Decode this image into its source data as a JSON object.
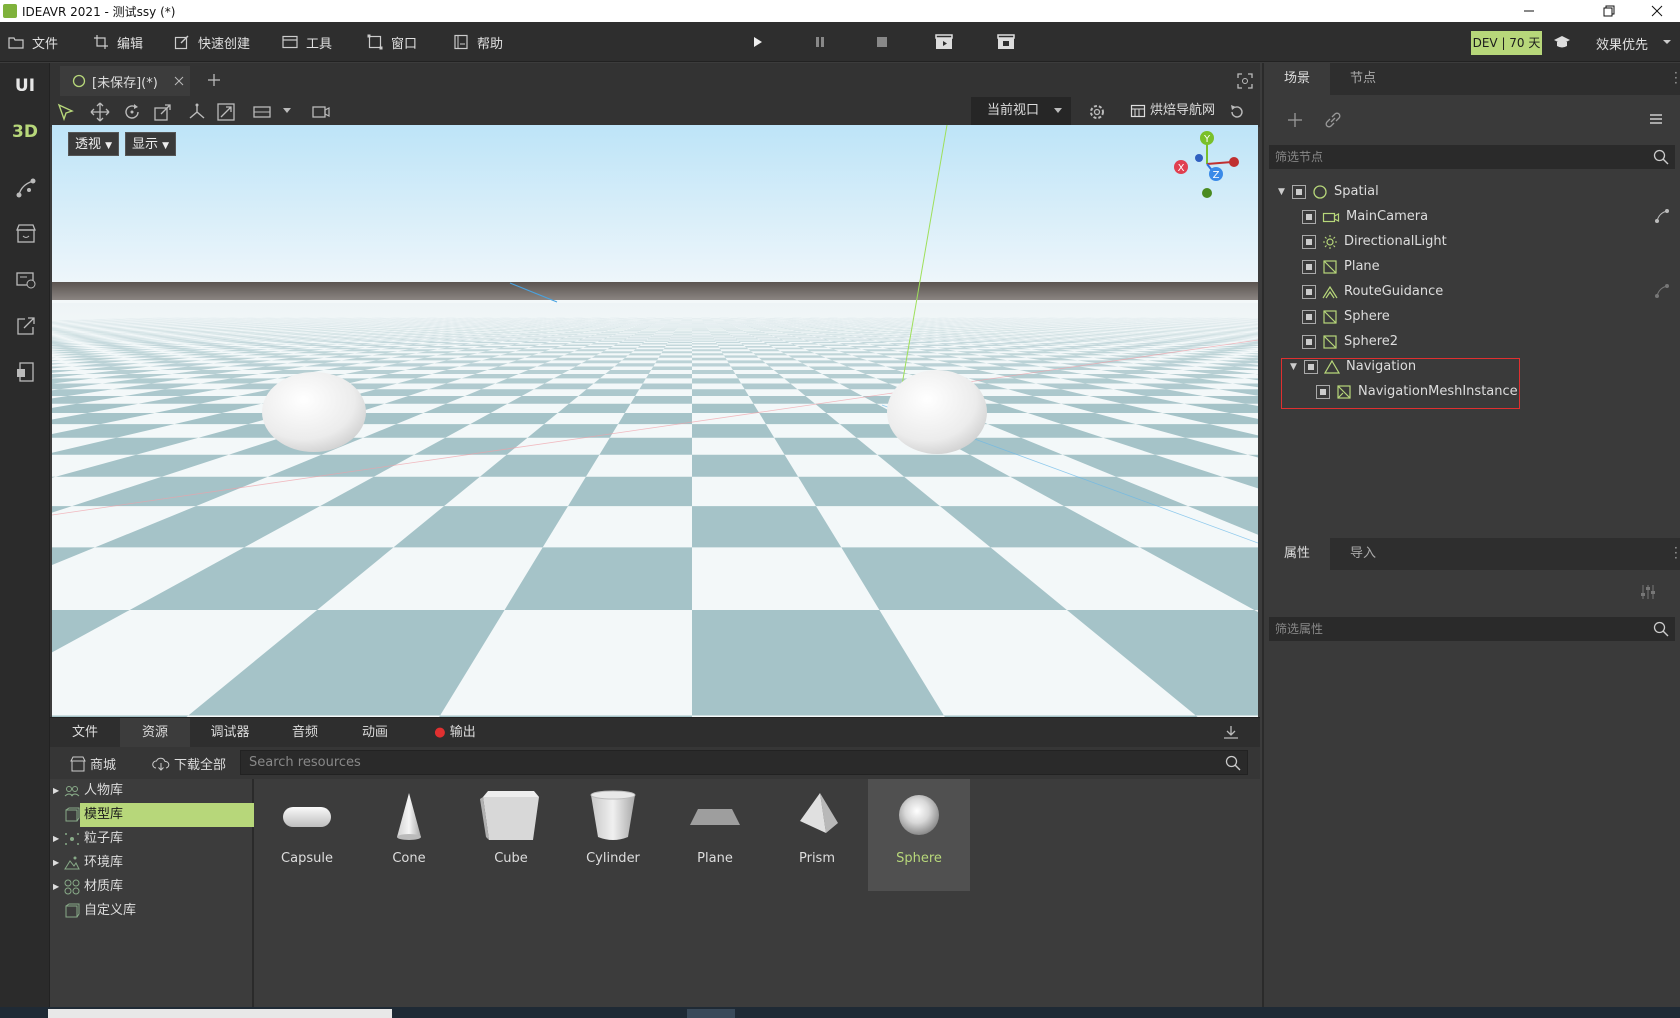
{
  "window": {
    "title": "IDEAVR 2021 - 测试ssy (*)"
  },
  "menu": {
    "items": [
      {
        "label": "文件",
        "icon": "folder-icon"
      },
      {
        "label": "编辑",
        "icon": "crop-icon"
      },
      {
        "label": "快速创建",
        "icon": "edit-icon"
      },
      {
        "label": "工具",
        "icon": "window-icon"
      },
      {
        "label": "窗口",
        "icon": "frame-icon"
      },
      {
        "label": "帮助",
        "icon": "book-icon"
      }
    ],
    "license_badge": "DEV | 70 天",
    "quality_label": "效果优先"
  },
  "leftbar": {
    "ui_label": "UI",
    "threed_label": "3D"
  },
  "scene": {
    "tab_label": "[未保存](*)",
    "view_select": "当前视口",
    "bake_nav_label": "烘焙导航网",
    "perspective_button": "透视",
    "display_button": "显示",
    "gizmo": {
      "x": "X",
      "y": "Y",
      "z": "Z"
    }
  },
  "bottom": {
    "tabs": [
      "文件",
      "资源",
      "调试器",
      "音频",
      "动画",
      "输出"
    ],
    "active_tab": "资源",
    "store_label": "商城",
    "download_all_label": "下载全部",
    "search_placeholder": "Search resources",
    "tree": [
      {
        "label": "人物库",
        "expandable": true
      },
      {
        "label": "模型库",
        "expandable": false,
        "active": true
      },
      {
        "label": "粒子库",
        "expandable": true
      },
      {
        "label": "环境库",
        "expandable": true
      },
      {
        "label": "材质库",
        "expandable": true
      },
      {
        "label": "自定义库",
        "expandable": false
      }
    ],
    "assets": [
      "Capsule",
      "Cone",
      "Cube",
      "Cylinder",
      "Plane",
      "Prism",
      "Sphere"
    ],
    "selected_asset": "Sphere"
  },
  "right": {
    "scene_tabs": [
      "场景",
      "节点"
    ],
    "filter_nodes_placeholder": "筛选节点",
    "nodes": [
      {
        "label": "Spatial",
        "icon": "spatial-icon",
        "depth": 0
      },
      {
        "label": "MainCamera",
        "icon": "camera-icon",
        "depth": 1
      },
      {
        "label": "DirectionalLight",
        "icon": "sun-icon",
        "depth": 1
      },
      {
        "label": "Plane",
        "icon": "mesh-icon",
        "depth": 1
      },
      {
        "label": "RouteGuidance",
        "icon": "route-icon",
        "depth": 1
      },
      {
        "label": "Sphere",
        "icon": "mesh-icon",
        "depth": 1
      },
      {
        "label": "Sphere2",
        "icon": "mesh-icon",
        "depth": 1
      },
      {
        "label": "Navigation",
        "icon": "navigation-icon",
        "depth": 1
      },
      {
        "label": "NavigationMeshInstance",
        "icon": "navmesh-icon",
        "depth": 2
      }
    ],
    "prop_tabs": [
      "属性",
      "导入"
    ],
    "filter_props_placeholder": "筛选属性"
  },
  "colors": {
    "accent": "#b7d77a",
    "highlight_box": "#e03030",
    "panel_bg": "#3c3c3c"
  }
}
